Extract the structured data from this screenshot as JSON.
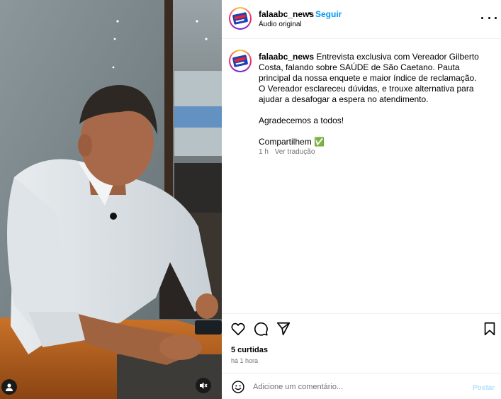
{
  "post": {
    "username": "falaabc_news",
    "separator": "•",
    "follow_label": "Seguir",
    "audio_label": "Áudio original",
    "more_icon": "more-horizontal-icon"
  },
  "caption": {
    "username": "falaabc_news",
    "line1": "Entrevista exclusiva com Vereador Gilberto Costa, falando sobre SAÚDE de São Caetano. Pauta principal da nossa enquete e maior índice de reclamação.",
    "line2": "O Vereador esclareceu dúvidas, e trouxe alternativa para ajudar a desafogar a espera no atendimento.",
    "line3": "Agradecemos a todos!",
    "line4": "Compartilhem ✅",
    "age": "1 h",
    "translate_label": "Ver tradução"
  },
  "actions": {
    "like_icon": "heart-icon",
    "comment_icon": "comment-icon",
    "share_icon": "send-icon",
    "save_icon": "bookmark-icon",
    "likes_text": "5 curtidas",
    "time_text": "há 1 hora"
  },
  "comment": {
    "placeholder": "Adicione um comentário...",
    "post_label": "Postar",
    "emoji_icon": "emoji-icon"
  },
  "media": {
    "user_tag_icon": "user-tag-icon",
    "mute_icon": "speaker-muted-icon"
  },
  "colors": {
    "link_blue": "#0095f6",
    "post_disabled": "#b2dffc",
    "muted_text": "#737373"
  }
}
